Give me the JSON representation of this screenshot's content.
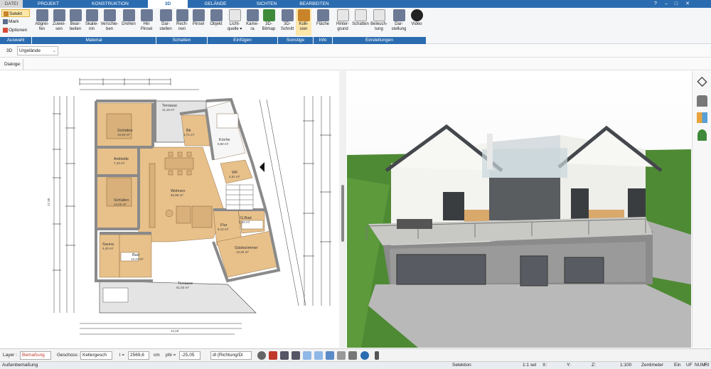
{
  "tabs": [
    "DATEI",
    "PROJEKT",
    "KONSTRUKTION",
    "3D",
    "GELÄNDE",
    "SICHTEN",
    "BEARBEITEN"
  ],
  "window_controls": [
    "?",
    "–",
    "□",
    "✕"
  ],
  "auswahl": {
    "selekt": "Selekt",
    "mark": "Mark",
    "optionen": "Optionen"
  },
  "ribbon": {
    "material": [
      "Abgrei-\nfen",
      "Zuwei-\nsen",
      "Bear-\nbeiten",
      "Skalie-\nnin",
      "Verschie-\nben",
      "Drehen",
      "Hin\nPinsel"
    ],
    "schatten": [
      "Dar-\nstellen",
      "Rech-\nnen",
      "Pinsel"
    ],
    "einfuegen": [
      "Objekt",
      "Licht-\nquelle ▾",
      "Kame-\nra",
      "3D-\nBitmap"
    ],
    "sonstige": [
      "3D-\nSchnitt",
      "Kolli-\nsion"
    ],
    "info": [
      "Fläche"
    ],
    "einstellungen": [
      "Hinter-\ngrund",
      "Schatten",
      "Beleuch-\ntung",
      "Dar-\nstellung",
      "Video"
    ]
  },
  "groups": [
    "Auswahl",
    "Material",
    "Schatten",
    "Einfügen",
    "Sonstige",
    "Info",
    "Einstellungen"
  ],
  "toolbar2": {
    "mode": "3D",
    "terrain": "Urgelände"
  },
  "toolbar3": {
    "dialoge": "Dialoge:"
  },
  "rooms": [
    {
      "name": "Schlafen",
      "area": "15,63 m²"
    },
    {
      "name": "Ankleide",
      "area": "7,43 m²"
    },
    {
      "name": "Schlafen",
      "area": "14,00 m²"
    },
    {
      "name": "Wohnen",
      "area": "52,96 m²"
    },
    {
      "name": "Terrasse",
      "area": "11,18 m²"
    },
    {
      "name": "Bk",
      "area": "4,71 m²"
    },
    {
      "name": "Küche",
      "area": "8,80 m²"
    },
    {
      "name": "WF",
      "area": "4,51 m²"
    },
    {
      "name": "G.Bad",
      "area": "4,00 m²"
    },
    {
      "name": "Flur",
      "area": "8,12 m²"
    },
    {
      "name": "Gästezimmer",
      "area": "13,25 m²"
    },
    {
      "name": "Sauna",
      "area": "4,40 m²"
    },
    {
      "name": "Bad",
      "area": "13,24 m²"
    },
    {
      "name": "Terrasse",
      "area": "51,93 m²"
    }
  ],
  "dims": {
    "bottom": "14,19",
    "left": "17,30"
  },
  "bottombar": {
    "layer_label": "Layer :",
    "layer_value": "Bemaßung",
    "geschoss_label": "Geschoss :",
    "geschoss_value": "Kellergesch",
    "l_label": "l =",
    "l_value": "2569,6",
    "unit": "cm",
    "phi_label": "phi =",
    "phi_value": "-25,05",
    "dl_value": "dl (Richtung/Di"
  },
  "status": {
    "left": "Außenbemaßung",
    "center": "Selektion",
    "sel": "1:1 sel",
    "x": "X:",
    "y": "Y:",
    "z": "Z:",
    "scale": "1:100",
    "unit": "Zentimeter",
    "ein": "Ein",
    "uf": "UF",
    "num": "NUM",
    "ri": "RI"
  },
  "colors": {
    "accent": "#2b6cb0",
    "floor": "#e8c08a",
    "grass": "#4e8a34",
    "wall": "#909090"
  }
}
